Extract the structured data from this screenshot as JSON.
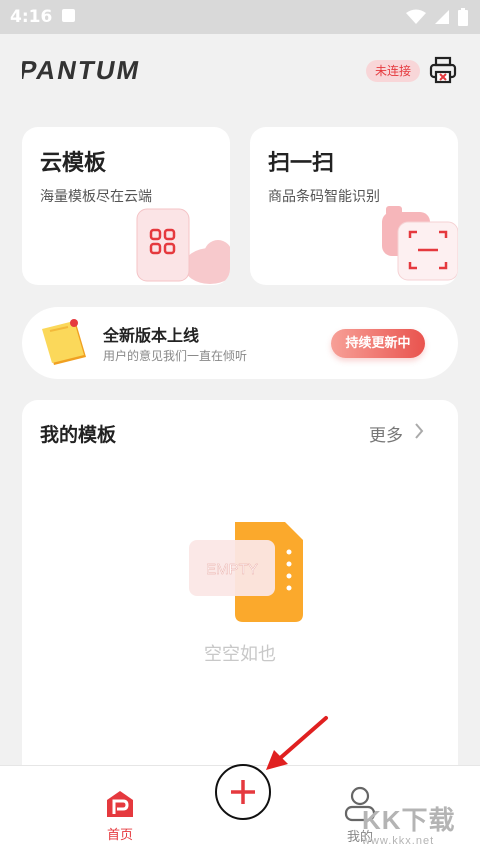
{
  "status_bar": {
    "time": "4:16"
  },
  "header": {
    "brand": "PANTUM",
    "connection_badge": "未连接"
  },
  "cards": {
    "cloud": {
      "title": "云模板",
      "subtitle": "海量模板尽在云端"
    },
    "scan": {
      "title": "扫一扫",
      "subtitle": "商品条码智能识别"
    }
  },
  "banner": {
    "title": "全新版本上线",
    "subtitle": "用户的意见我们一直在倾听",
    "button": "持续更新中"
  },
  "templates": {
    "title": "我的模板",
    "more": "更多",
    "empty_badge": "EMPTY",
    "empty_text": "空空如也"
  },
  "tabbar": {
    "home": "首页",
    "me": "我的"
  },
  "watermark": {
    "big": "KK下载",
    "small": "www.kkx.net"
  },
  "colors": {
    "brand_red": "#e5393e",
    "background": "#f1f1f1",
    "card": "#ffffff"
  }
}
